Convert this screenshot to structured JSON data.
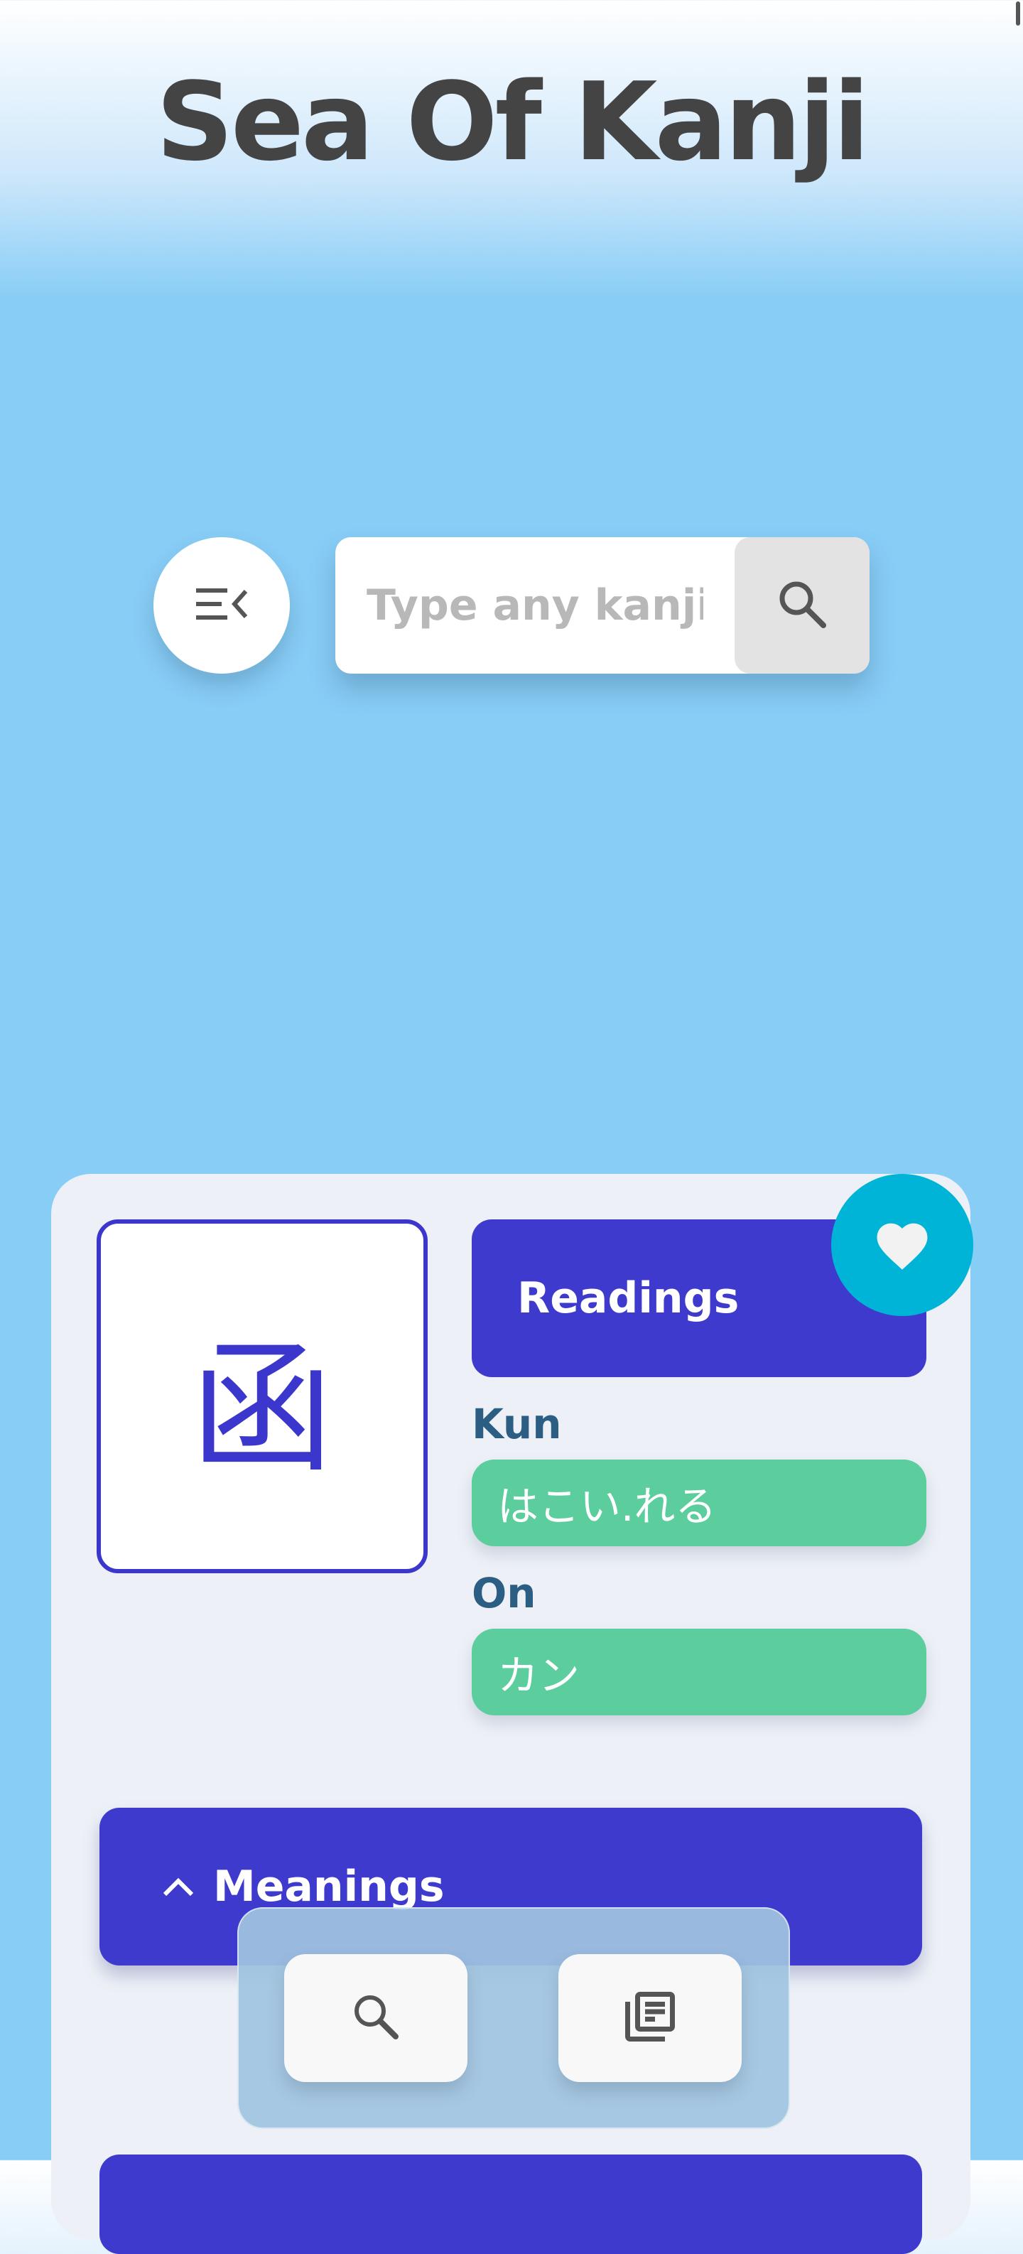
{
  "app": {
    "title": "Sea Of Kanji"
  },
  "search": {
    "placeholder": "Type any kanji",
    "value": ""
  },
  "icons": {
    "menu": "menu-collapse-icon",
    "search": "search-icon",
    "favorite": "heart-icon",
    "expand": "chevron-up-icon",
    "list": "library-books-icon"
  },
  "colors": {
    "primary": "#3d3acd",
    "accent": "#00b4d8",
    "reading_pill": "#5ccd9c",
    "label": "#2c5e84",
    "background": "#88cdf6",
    "card": "#edf1f7"
  },
  "kanji": {
    "character": "函",
    "readings_title": "Readings",
    "kun_label": "Kun",
    "kun_value": "はこい.れる",
    "on_label": "On",
    "on_value": "カン"
  },
  "meanings": {
    "title": "Meanings",
    "expanded": true
  }
}
